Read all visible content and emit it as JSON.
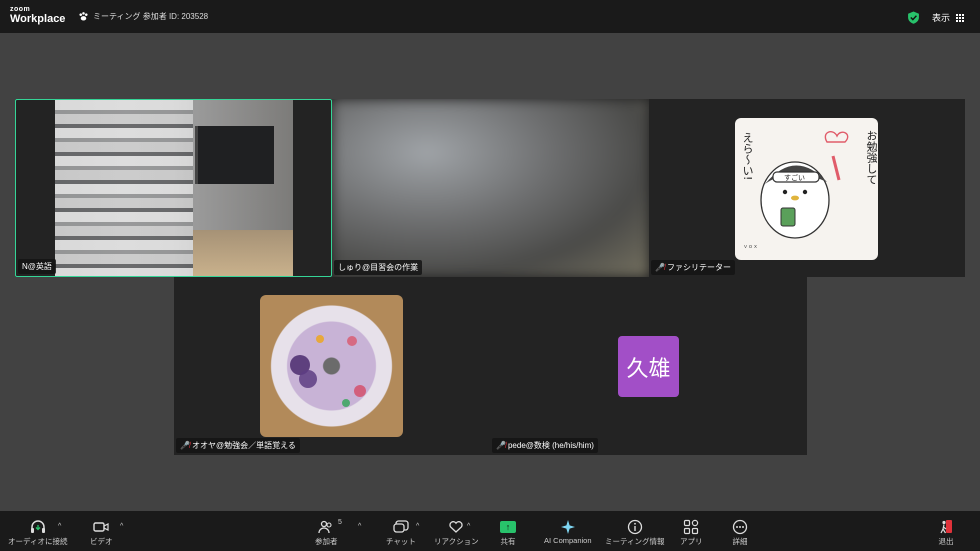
{
  "topbar": {
    "logo_small": "zoom",
    "logo_big": "Workplace",
    "meeting_info": "ミーティング 参加者 ID: 203528",
    "view_label": "表示"
  },
  "participants": [
    {
      "name": "N@英語",
      "muted": false,
      "video": "camera"
    },
    {
      "name": "しゅり@目習会の作業",
      "muted": false,
      "video": "camera"
    },
    {
      "name": "ファシリテーター",
      "muted": true,
      "video": "camera"
    },
    {
      "name": "オオヤ@勉強会／単語覚える",
      "muted": true,
      "video": "camera"
    },
    {
      "name": "pede@数検 (he/his/him)",
      "muted": true,
      "video": "off",
      "avatar_text": "久雄"
    }
  ],
  "sticker_text": {
    "right": "お勉強して",
    "left": "えら〜い!",
    "small": "すごい"
  },
  "toolbar": {
    "audio": "オーディオに接続",
    "video": "ビデオ",
    "participants": "参加者",
    "participants_count": "5",
    "chat": "チャット",
    "reactions": "リアクション",
    "share": "共有",
    "ai": "AI Companion",
    "info": "ミーティング情報",
    "apps": "アプリ",
    "more": "詳細",
    "leave": "退出"
  },
  "colors": {
    "active_speaker_border": "#35d597",
    "share_green": "#28c26b",
    "avatar_purple": "#a24fc7",
    "muted_red": "#e0323a"
  }
}
